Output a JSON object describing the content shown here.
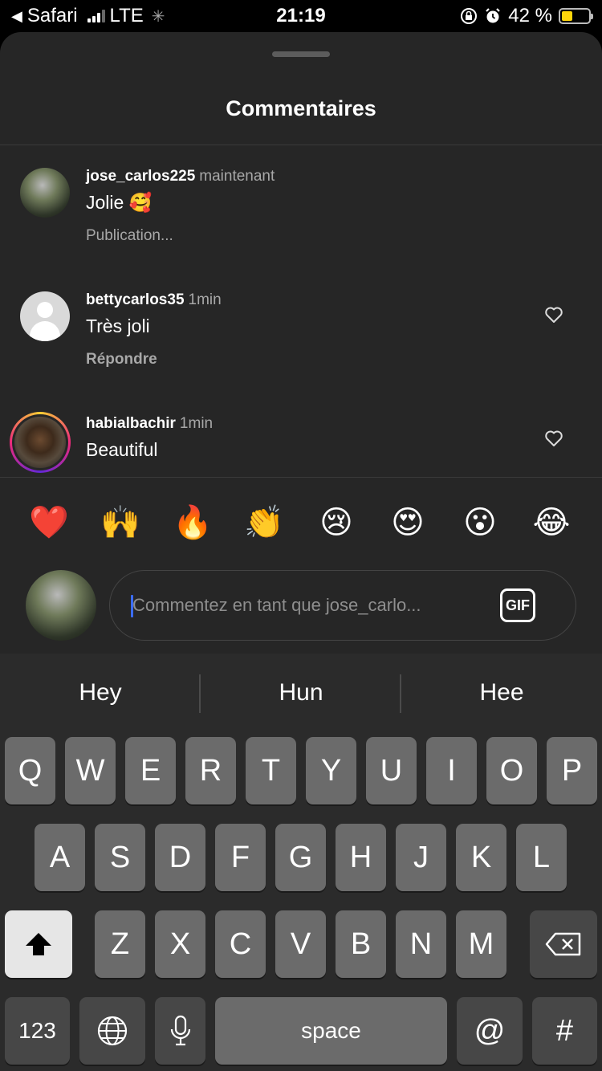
{
  "status_bar": {
    "back_app": "Safari",
    "network": "LTE",
    "time": "21:19",
    "battery_percent": "42 %",
    "battery_level": 0.42,
    "battery_color": "#ffd60a"
  },
  "sheet": {
    "title": "Commentaires"
  },
  "comments": [
    {
      "username": "jose_carlos225",
      "time": "maintenant",
      "text": "Jolie 🥰",
      "action": "Publication...",
      "avatar": "photo"
    },
    {
      "username": "bettycarlos35",
      "time": "1min",
      "text": "Très joli",
      "action": "Répondre",
      "avatar": "default"
    },
    {
      "username": "habialbachir",
      "time": "1min",
      "text": "Beautiful",
      "action": "",
      "avatar": "photo-story"
    }
  ],
  "emoji_bar": [
    "❤️",
    "🙌",
    "🔥",
    "👏",
    "😢",
    "😍",
    "😮",
    "😂"
  ],
  "composer": {
    "placeholder": "Commentez en tant que jose_carlo...",
    "gif_label": "GIF"
  },
  "keyboard": {
    "suggestions": [
      "Hey",
      "Hun",
      "Hee"
    ],
    "row1": [
      "Q",
      "W",
      "E",
      "R",
      "T",
      "Y",
      "U",
      "I",
      "O",
      "P"
    ],
    "row2": [
      "A",
      "S",
      "D",
      "F",
      "G",
      "H",
      "J",
      "K",
      "L"
    ],
    "row3": [
      "Z",
      "X",
      "C",
      "V",
      "B",
      "N",
      "M"
    ],
    "numbers_label": "123",
    "space_label": "space",
    "at_label": "@",
    "hash_label": "#"
  },
  "icons": [
    "back-arrow-icon",
    "signal-icon",
    "loading-icon",
    "orientation-lock-icon",
    "alarm-icon",
    "battery-icon",
    "heart-icon",
    "gif-icon",
    "shift-icon",
    "backspace-icon",
    "globe-icon",
    "microphone-icon"
  ]
}
